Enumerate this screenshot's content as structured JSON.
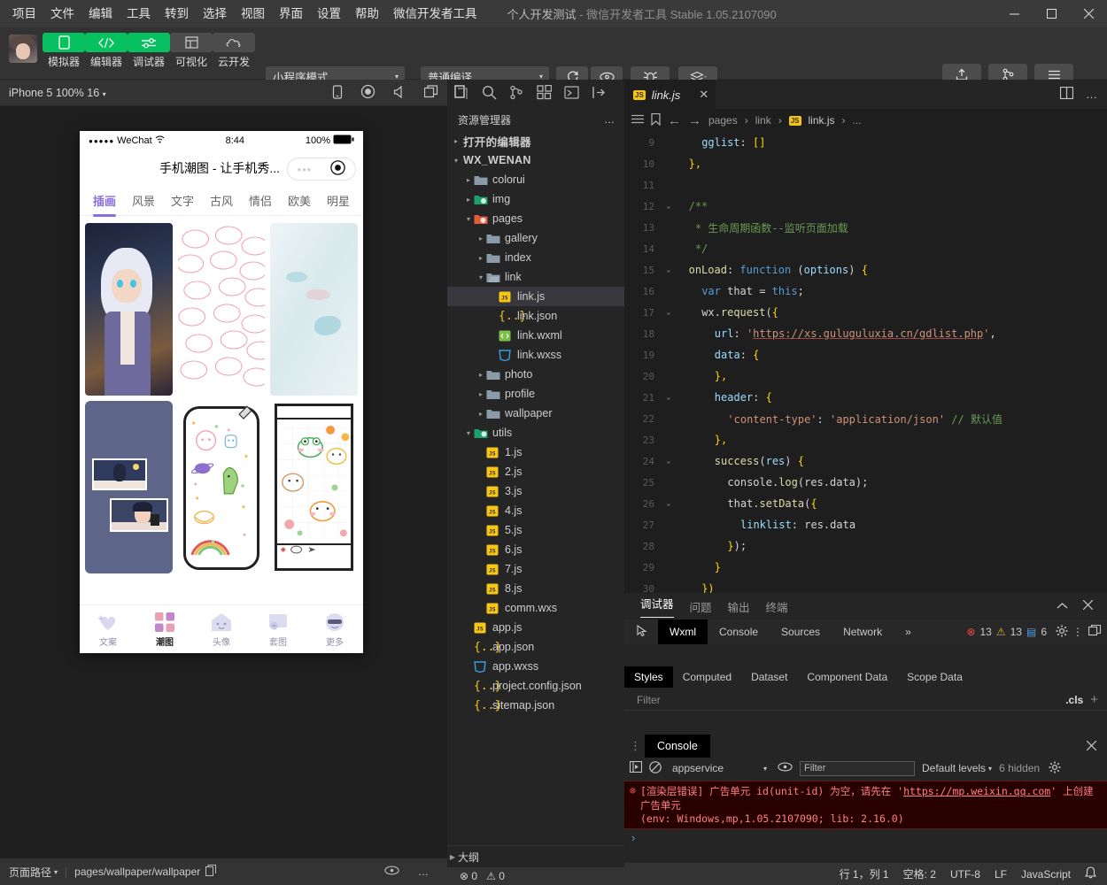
{
  "titlebar": {
    "menus": [
      "项目",
      "文件",
      "编辑",
      "工具",
      "转到",
      "选择",
      "视图",
      "界面",
      "设置",
      "帮助",
      "微信开发者工具"
    ],
    "project_name": "个人开发测试",
    "separator": "-",
    "app_name": "微信开发者工具",
    "version": "Stable 1.05.2107090",
    "window_controls": {
      "minimize": "minimize-icon",
      "maximize": "maximize-icon",
      "close": "close-icon"
    }
  },
  "toolbar": {
    "buttons": [
      {
        "label": "模拟器",
        "icon": "phone-icon",
        "style": "green"
      },
      {
        "label": "编辑器",
        "icon": "code-icon",
        "style": "green"
      },
      {
        "label": "调试器",
        "icon": "debug-slider-icon",
        "style": "green"
      },
      {
        "label": "可视化",
        "icon": "layout-icon",
        "style": "gray"
      },
      {
        "label": "云开发",
        "icon": "cloud-icon",
        "style": "gray"
      }
    ],
    "mode_select": "小程序模式",
    "compile_select": "普通编译",
    "actions": [
      {
        "label": "编译",
        "icon": "refresh-icon"
      },
      {
        "label": "预览",
        "icon": "eye-icon"
      },
      {
        "label": "真机调试",
        "icon": "bug-icon"
      },
      {
        "label": "清缓存",
        "icon": "layers-icon"
      }
    ],
    "right_actions": [
      {
        "label": "上传",
        "icon": "upload-icon"
      },
      {
        "label": "版本管理",
        "icon": "branch-icon"
      },
      {
        "label": "详情",
        "icon": "menu-icon"
      }
    ]
  },
  "simulator": {
    "device_label": "iPhone 5 100% 16",
    "top_icons": [
      "phone-rotate-icon",
      "record-icon",
      "volume-icon",
      "window-icon"
    ],
    "status": {
      "carrier": "WeChat",
      "dots": "●●●●●",
      "wifi": "wifi-icon",
      "time": "8:44",
      "battery_percent": "100%"
    },
    "nav_title": "手机潮图 - 让手机秀...",
    "capsule": {
      "more": "more-dots-icon",
      "target": "target-icon"
    },
    "category_tabs": [
      "插画",
      "风景",
      "文字",
      "古风",
      "情侣",
      "欧美",
      "明星"
    ],
    "active_category": "插画",
    "bottom_tabs": [
      {
        "label": "文案",
        "icon": "heart-sparkle-icon",
        "active": false
      },
      {
        "label": "潮图",
        "icon": "grid-squares-icon",
        "active": true
      },
      {
        "label": "头像",
        "icon": "house-face-icon",
        "active": false
      },
      {
        "label": "套图",
        "icon": "folder-face-icon",
        "active": false
      },
      {
        "label": "更多",
        "icon": "sunglasses-face-icon",
        "active": false
      }
    ]
  },
  "explorer": {
    "activity_icons": [
      "files-icon",
      "search-icon",
      "source-control-icon",
      "extensions-icon",
      "test-icon",
      "collapse-icon"
    ],
    "title": "资源管理器",
    "more": "…",
    "sections": [
      {
        "label": "打开的编辑器",
        "expanded": false,
        "level": 0,
        "type": "section"
      },
      {
        "label": "WX_WENAN",
        "expanded": true,
        "level": 0,
        "type": "section"
      },
      {
        "label": "colorui",
        "expanded": false,
        "level": 1,
        "type": "folder"
      },
      {
        "label": "img",
        "expanded": false,
        "level": 1,
        "type": "folder-green"
      },
      {
        "label": "pages",
        "expanded": true,
        "level": 1,
        "type": "folder-red"
      },
      {
        "label": "gallery",
        "expanded": false,
        "level": 2,
        "type": "folder"
      },
      {
        "label": "index",
        "expanded": false,
        "level": 2,
        "type": "folder"
      },
      {
        "label": "link",
        "expanded": true,
        "level": 2,
        "type": "folder-open"
      },
      {
        "label": "link.js",
        "level": 3,
        "type": "js",
        "selected": true
      },
      {
        "label": "link.json",
        "level": 3,
        "type": "json"
      },
      {
        "label": "link.wxml",
        "level": 3,
        "type": "wxml"
      },
      {
        "label": "link.wxss",
        "level": 3,
        "type": "wxss"
      },
      {
        "label": "photo",
        "expanded": false,
        "level": 2,
        "type": "folder"
      },
      {
        "label": "profile",
        "expanded": false,
        "level": 2,
        "type": "folder"
      },
      {
        "label": "wallpaper",
        "expanded": false,
        "level": 2,
        "type": "folder"
      },
      {
        "label": "utils",
        "expanded": true,
        "level": 1,
        "type": "folder-green-open"
      },
      {
        "label": "1.js",
        "level": 2,
        "type": "js"
      },
      {
        "label": "2.js",
        "level": 2,
        "type": "js"
      },
      {
        "label": "3.js",
        "level": 2,
        "type": "js"
      },
      {
        "label": "4.js",
        "level": 2,
        "type": "js"
      },
      {
        "label": "5.js",
        "level": 2,
        "type": "js"
      },
      {
        "label": "6.js",
        "level": 2,
        "type": "js"
      },
      {
        "label": "7.js",
        "level": 2,
        "type": "js"
      },
      {
        "label": "8.js",
        "level": 2,
        "type": "js"
      },
      {
        "label": "comm.wxs",
        "level": 2,
        "type": "js"
      },
      {
        "label": "app.js",
        "level": 1,
        "type": "js"
      },
      {
        "label": "app.json",
        "level": 1,
        "type": "json"
      },
      {
        "label": "app.wxss",
        "level": 1,
        "type": "wxss"
      },
      {
        "label": "project.config.json",
        "level": 1,
        "type": "json"
      },
      {
        "label": "sitemap.json",
        "level": 1,
        "type": "json"
      }
    ],
    "outline_label": "大纲"
  },
  "editor": {
    "tab": {
      "label": "link.js",
      "icon": "js-icon",
      "close": "close-icon"
    },
    "split_icon": "split-editor-icon",
    "more_icon": "more-icon",
    "breadcrumb": [
      "pages",
      "link",
      "link.js",
      "..."
    ],
    "nav_icons": [
      "outline-icon",
      "bookmark-icon",
      "back-icon",
      "forward-icon"
    ],
    "lines": [
      {
        "no": "9",
        "fold": "",
        "indent": 4,
        "tokens": [
          [
            "k-prop",
            "gglist"
          ],
          [
            "k-pun",
            ": "
          ],
          [
            "k-brk",
            "[]"
          ]
        ]
      },
      {
        "no": "10",
        "fold": "",
        "indent": 2,
        "tokens": [
          [
            "k-brk",
            "},"
          ]
        ]
      },
      {
        "no": "11",
        "fold": "",
        "indent": 0,
        "tokens": []
      },
      {
        "no": "12",
        "fold": "v",
        "indent": 2,
        "tokens": [
          [
            "k-cmt",
            "/**"
          ]
        ]
      },
      {
        "no": "13",
        "fold": "",
        "indent": 2,
        "tokens": [
          [
            "k-cmt",
            " * 生命周期函数--监听页面加载"
          ]
        ]
      },
      {
        "no": "14",
        "fold": "",
        "indent": 2,
        "tokens": [
          [
            "k-cmt",
            " */"
          ]
        ]
      },
      {
        "no": "15",
        "fold": "v",
        "indent": 2,
        "tokens": [
          [
            "k-mth",
            "onLoad"
          ],
          [
            "k-pun",
            ": "
          ],
          [
            "k-kw",
            "function"
          ],
          [
            "k-pun",
            " ("
          ],
          [
            "k-par",
            "options"
          ],
          [
            "k-pun",
            ") "
          ],
          [
            "k-brk",
            "{"
          ]
        ]
      },
      {
        "no": "16",
        "fold": "",
        "indent": 4,
        "tokens": [
          [
            "k-kw",
            "var"
          ],
          [
            "k-pun",
            " that = "
          ],
          [
            "k-kw",
            "this"
          ],
          [
            "k-pun",
            ";"
          ]
        ]
      },
      {
        "no": "17",
        "fold": "v",
        "indent": 4,
        "tokens": [
          [
            "k-pun",
            "wx."
          ],
          [
            "k-mth",
            "request"
          ],
          [
            "k-pun",
            "("
          ],
          [
            "k-brk",
            "{"
          ]
        ]
      },
      {
        "no": "18",
        "fold": "",
        "indent": 6,
        "tokens": [
          [
            "k-prop",
            "url"
          ],
          [
            "k-pun",
            ": "
          ],
          [
            "k-str",
            "'"
          ],
          [
            "k-url",
            "https://xs.guluguluxia.cn/gdlist.php"
          ],
          [
            "k-str",
            "'"
          ],
          [
            "k-pun",
            ","
          ]
        ]
      },
      {
        "no": "19",
        "fold": "",
        "indent": 6,
        "tokens": [
          [
            "k-prop",
            "data"
          ],
          [
            "k-pun",
            ": "
          ],
          [
            "k-brk",
            "{"
          ]
        ]
      },
      {
        "no": "20",
        "fold": "",
        "indent": 6,
        "tokens": [
          [
            "k-brk",
            "},"
          ]
        ]
      },
      {
        "no": "21",
        "fold": "v",
        "indent": 6,
        "tokens": [
          [
            "k-prop",
            "header"
          ],
          [
            "k-pun",
            ": "
          ],
          [
            "k-brk",
            "{"
          ]
        ]
      },
      {
        "no": "22",
        "fold": "",
        "indent": 8,
        "tokens": [
          [
            "k-str",
            "'content-type'"
          ],
          [
            "k-pun",
            ": "
          ],
          [
            "k-str",
            "'application/json'"
          ],
          [
            "k-pun",
            " "
          ],
          [
            "k-cmt",
            "// 默认值"
          ]
        ]
      },
      {
        "no": "23",
        "fold": "",
        "indent": 6,
        "tokens": [
          [
            "k-brk",
            "},"
          ]
        ]
      },
      {
        "no": "24",
        "fold": "v",
        "indent": 6,
        "tokens": [
          [
            "k-mth",
            "success"
          ],
          [
            "k-pun",
            "("
          ],
          [
            "k-par",
            "res"
          ],
          [
            "k-pun",
            ") "
          ],
          [
            "k-brk",
            "{"
          ]
        ]
      },
      {
        "no": "25",
        "fold": "",
        "indent": 8,
        "tokens": [
          [
            "k-pun",
            "console."
          ],
          [
            "k-mth",
            "log"
          ],
          [
            "k-pun",
            "(res.data);"
          ]
        ]
      },
      {
        "no": "26",
        "fold": "v",
        "indent": 8,
        "tokens": [
          [
            "k-pun",
            "that."
          ],
          [
            "k-mth",
            "setData"
          ],
          [
            "k-pun",
            "("
          ],
          [
            "k-brk",
            "{"
          ]
        ]
      },
      {
        "no": "27",
        "fold": "",
        "indent": 10,
        "tokens": [
          [
            "k-prop",
            "linklist"
          ],
          [
            "k-pun",
            ": res.data"
          ]
        ]
      },
      {
        "no": "28",
        "fold": "",
        "indent": 8,
        "tokens": [
          [
            "k-brk",
            "}"
          ],
          [
            "k-pun",
            ");"
          ]
        ]
      },
      {
        "no": "29",
        "fold": "",
        "indent": 6,
        "tokens": [
          [
            "k-brk",
            "}"
          ]
        ]
      },
      {
        "no": "30",
        "fold": "",
        "indent": 4,
        "tokens": [
          [
            "k-brk",
            "})"
          ]
        ]
      }
    ]
  },
  "debugger": {
    "panel_tabs": [
      "调试器",
      "问题",
      "输出",
      "终端"
    ],
    "panel_active": "调试器",
    "collapse_icon": "chevron-up-icon",
    "close_icon": "close-icon",
    "devtools_tabs": [
      "Wxml",
      "Console",
      "Sources",
      "Network"
    ],
    "devtools_active": "Wxml",
    "overflow": "»",
    "inspect_icon": "inspect-icon",
    "counts": {
      "errors": "13",
      "warnings": "13",
      "info": "6"
    },
    "settings_icon": "gear-icon",
    "kebab_icon": "kebab-icon",
    "dock_icon": "dock-icon",
    "styles_tabs": [
      "Styles",
      "Computed",
      "Dataset",
      "Component Data",
      "Scope Data"
    ],
    "styles_active": "Styles",
    "filter_placeholder": "Filter",
    "cls_label": ".cls",
    "plus_label": "+",
    "console": {
      "title": "Console",
      "close_icon": "close-icon",
      "play_icon": "execute-icon",
      "clear_icon": "clear-icon",
      "context": "appservice",
      "eye_icon": "eye-icon",
      "filter_placeholder": "Filter",
      "levels": "Default levels",
      "hidden": "6 hidden",
      "gear_icon": "gear-icon",
      "error": {
        "prefix": "[渲染层错误] 广告单元 id(unit-id) 为空，请先在 '",
        "link": "https://mp.weixin.qq.com",
        "suffix": "' 上创建广告单元",
        "env": "(env: Windows,mp,1.05.2107090; lib: 2.16.0)"
      },
      "prompt": "›"
    }
  },
  "statusbar": {
    "page_path_label": "页面路径",
    "page_path_value": "pages/wallpaper/wallpaper",
    "copy_icon": "copy-icon",
    "eye_icon": "eye-icon",
    "more_icon": "more-icon",
    "problems": {
      "errors": "0",
      "warnings": "0"
    },
    "right": [
      "行 1，列 1",
      "空格: 2",
      "UTF-8",
      "LF",
      "JavaScript"
    ],
    "bell_icon": "bell-icon"
  }
}
